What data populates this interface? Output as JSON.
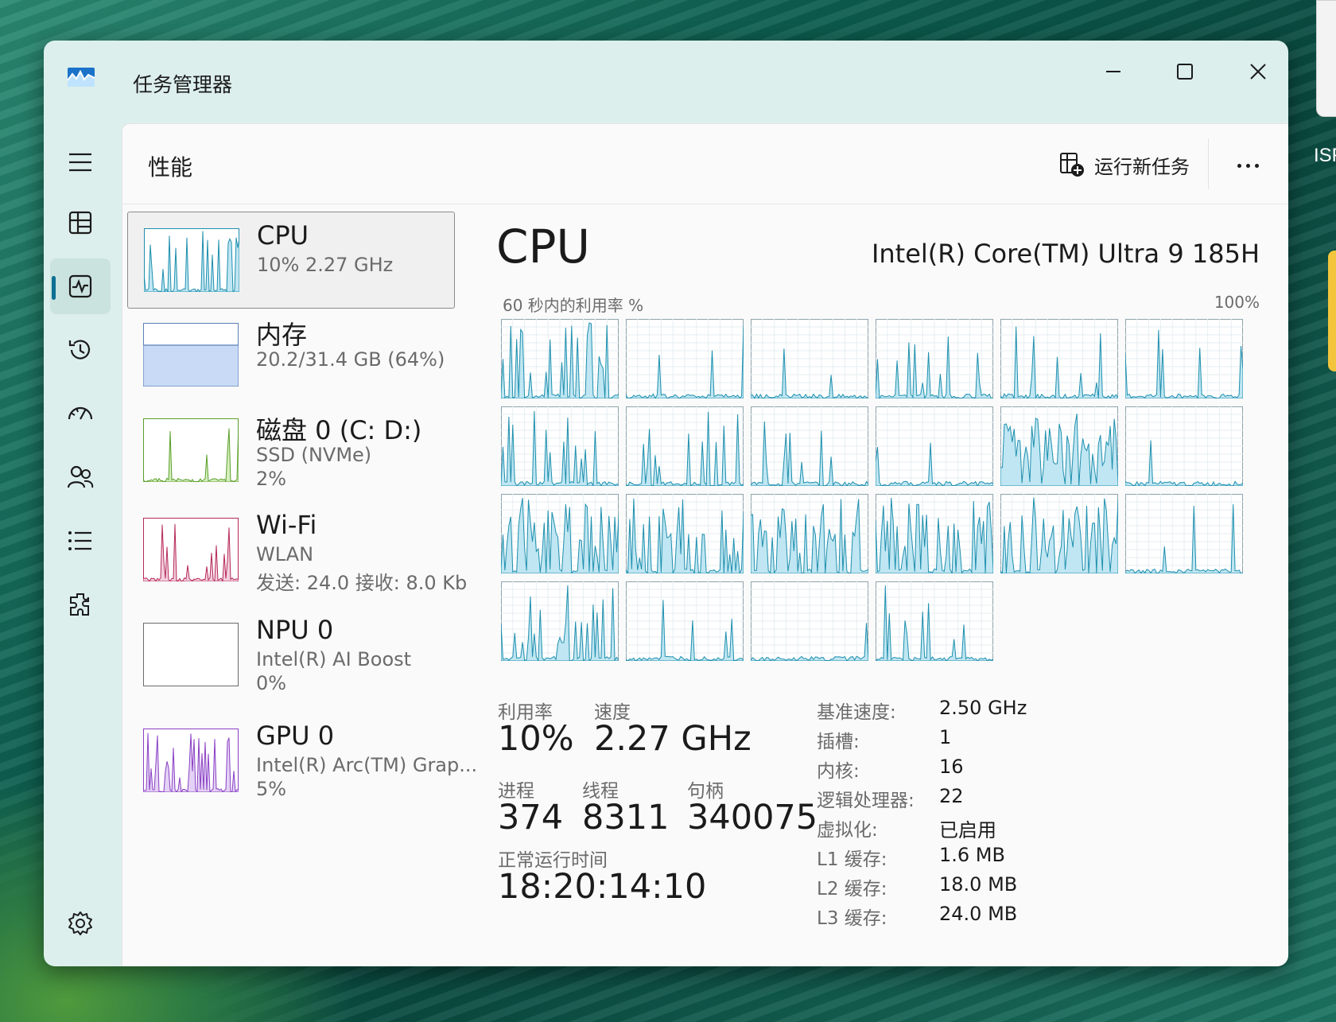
{
  "window": {
    "title": "任务管理器"
  },
  "desktop": {
    "partial_text": "ISF"
  },
  "nav": {
    "items": [
      {
        "name": "menu-icon"
      },
      {
        "name": "processes-icon"
      },
      {
        "name": "performance-icon",
        "active": true
      },
      {
        "name": "app-history-icon"
      },
      {
        "name": "startup-apps-icon"
      },
      {
        "name": "users-icon"
      },
      {
        "name": "details-icon"
      },
      {
        "name": "services-icon"
      },
      {
        "name": "settings-icon"
      }
    ]
  },
  "header": {
    "title": "性能",
    "run_task_label": "运行新任务"
  },
  "devices": [
    {
      "name": "CPU",
      "sub1": "10%  2.27 GHz",
      "sub2": "",
      "sub3": "",
      "color": "#1e8fae",
      "fill": "#bfe6f2"
    },
    {
      "name": "内存",
      "sub1": "20.2/31.4 GB (64%)",
      "sub2": "",
      "sub3": "",
      "color": "#5b7fb8",
      "fill": "#c9daf6"
    },
    {
      "name": "磁盘 0 (C: D:)",
      "sub1": "SSD (NVMe)",
      "sub2": "2%",
      "sub3": "",
      "color": "#5a9e2a",
      "fill": "#d6efbe"
    },
    {
      "name": "Wi-Fi",
      "sub1": "WLAN",
      "sub2": "发送: 24.0  接收: 8.0 Kb",
      "sub3": "",
      "color": "#b5295a",
      "fill": "#f3cfdc"
    },
    {
      "name": "NPU 0",
      "sub1": "Intel(R) AI Boost",
      "sub2": "0%",
      "sub3": "",
      "color": "#1e8fae",
      "fill": "#ffffff"
    },
    {
      "name": "GPU 0",
      "sub1": "Intel(R) Arc(TM) Grap...",
      "sub2": "5%",
      "sub3": "",
      "color": "#8a3fc4",
      "fill": "#e3d2f5"
    }
  ],
  "cpu": {
    "title": "CPU",
    "model": "Intel(R) Core(TM) Ultra 9 185H",
    "graph_label_left": "60 秒内的利用率 %",
    "graph_label_right": "100%",
    "core_count": 22,
    "stats": {
      "utilization_label": "利用率",
      "utilization": "10%",
      "speed_label": "速度",
      "speed": "2.27 GHz",
      "processes_label": "进程",
      "processes": "374",
      "threads_label": "线程",
      "threads": "8311",
      "handles_label": "句柄",
      "handles": "340075",
      "uptime_label": "正常运行时间",
      "uptime": "18:20:14:10"
    },
    "specs": [
      {
        "label": "基准速度:",
        "value": "2.50 GHz"
      },
      {
        "label": "插槽:",
        "value": "1"
      },
      {
        "label": "内核:",
        "value": "16"
      },
      {
        "label": "逻辑处理器:",
        "value": "22"
      },
      {
        "label": "虚拟化:",
        "value": "已启用"
      },
      {
        "label": "L1 缓存:",
        "value": "1.6 MB"
      },
      {
        "label": "L2 缓存:",
        "value": "18.0 MB"
      },
      {
        "label": "L3 缓存:",
        "value": "24.0 MB"
      }
    ]
  },
  "colors": {
    "cpu_line": "#1e8fae",
    "cpu_fill": "#bfe6f2",
    "accent": "#0d6f92"
  }
}
